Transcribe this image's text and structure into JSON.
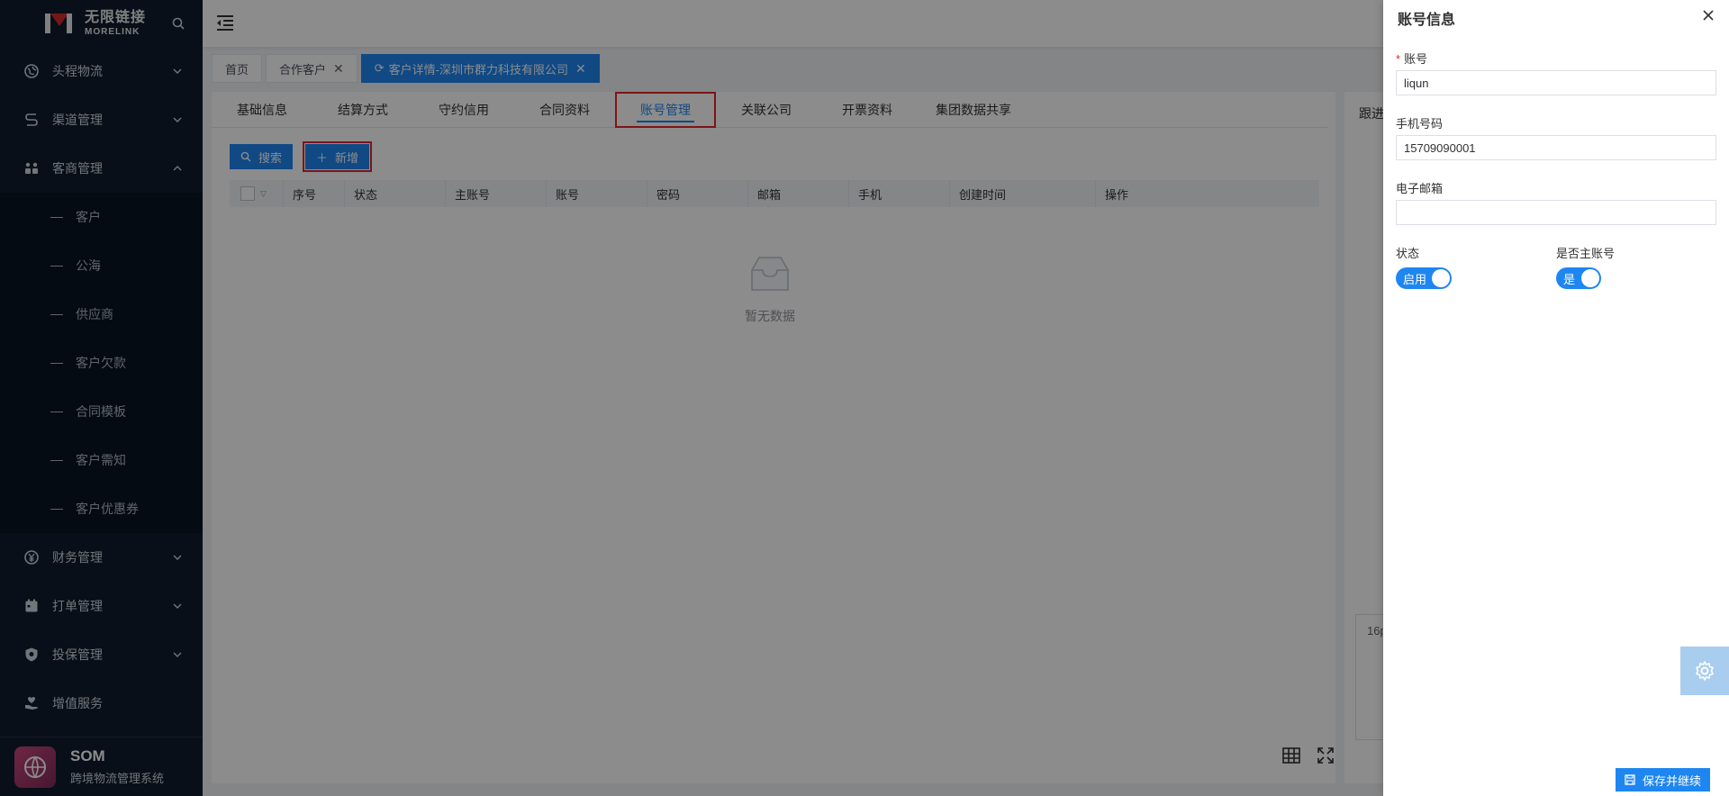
{
  "brand": {
    "name_cn": "无限链接",
    "name_en": "MORELINK"
  },
  "sidebar": {
    "items": [
      {
        "label": "头程物流",
        "icon": "globe-icon"
      },
      {
        "label": "渠道管理",
        "icon": "route-icon"
      },
      {
        "label": "客商管理",
        "icon": "people-icon",
        "expanded": true
      }
    ],
    "sub_items": [
      "客户",
      "公海",
      "供应商",
      "客户欠款",
      "合同模板",
      "客户需知",
      "客户优惠券"
    ],
    "items_after": [
      {
        "label": "财务管理",
        "icon": "yen-icon"
      },
      {
        "label": "打单管理",
        "icon": "calendar-icon"
      },
      {
        "label": "投保管理",
        "icon": "shield-icon"
      },
      {
        "label": "增值服务",
        "icon": "heart-hand-icon"
      }
    ],
    "footer": {
      "title": "SOM",
      "subtitle": "跨境物流管理系统"
    }
  },
  "tags": [
    {
      "label": "首页"
    },
    {
      "label": "合作客户"
    },
    {
      "label": "客户详情-深圳市群力科技有限公司"
    }
  ],
  "tabs": [
    "基础信息",
    "结算方式",
    "守约信用",
    "合同资料",
    "账号管理",
    "关联公司",
    "开票资料",
    "集团数据共享"
  ],
  "toolbar": {
    "search": "搜索",
    "add": "新增"
  },
  "table": {
    "columns": [
      "序号",
      "状态",
      "主账号",
      "账号",
      "密码",
      "邮箱",
      "手机",
      "创建时间",
      "操作"
    ],
    "empty_text": "暂无数据"
  },
  "right_panel": {
    "title": "跟进",
    "box_text": "16p"
  },
  "drawer": {
    "title": "账号信息",
    "account_label": "账号",
    "account_value": "liqun",
    "phone_label": "手机号码",
    "phone_value": "15709090001",
    "email_label": "电子邮箱",
    "email_value": "",
    "status_label": "状态",
    "status_switch": "启用",
    "main_label": "是否主账号",
    "main_switch": "是",
    "save_label": "保存并继续"
  },
  "colors": {
    "primary": "#1e86f0",
    "sidebar": "#0f1c2e",
    "highlight": "#e4262e"
  }
}
